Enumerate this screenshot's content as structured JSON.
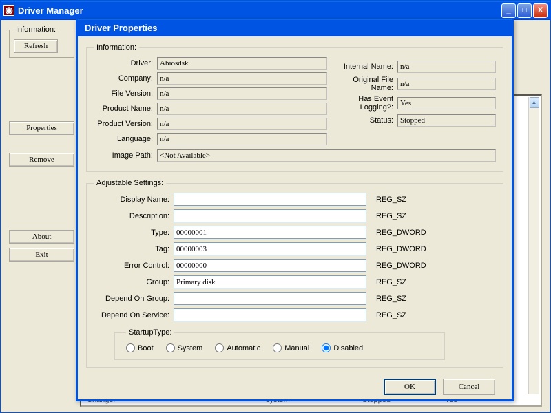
{
  "main": {
    "title": "Driver Manager",
    "info_legend": "Information:",
    "refresh": "Refresh",
    "properties": "Properties",
    "remove": "Remove",
    "about": "About",
    "exit": "Exit",
    "behind_row": {
      "c1": "Changer",
      "c2": "system",
      "c3": "Stopped",
      "c4": "Yes"
    }
  },
  "dialog": {
    "title": "Driver Properties",
    "info_legend": "Information:",
    "adj_legend": "Adjustable Settings:",
    "startup_legend": "StartupType:",
    "ok": "OK",
    "cancel": "Cancel",
    "info": {
      "driver_label": "Driver:",
      "driver": "Abiosdsk",
      "company_label": "Company:",
      "company": "n/a",
      "filever_label": "File Version:",
      "filever": "n/a",
      "prodname_label": "Product Name:",
      "prodname": "n/a",
      "prodver_label": "Product Version:",
      "prodver": "n/a",
      "language_label": "Language:",
      "language": "n/a",
      "image_label": "Image Path:",
      "image": "<Not Available>",
      "internal_label": "Internal Name:",
      "internal": "n/a",
      "origfile_label": "Original File Name:",
      "origfile": "n/a",
      "evlog_label": "Has Event Logging?:",
      "evlog": "Yes",
      "status_label": "Status:",
      "status": "Stopped"
    },
    "adj": {
      "display_label": "Display Name:",
      "display": "",
      "display_t": "REG_SZ",
      "desc_label": "Description:",
      "desc": "",
      "desc_t": "REG_SZ",
      "type_label": "Type:",
      "type": "00000001",
      "type_t": "REG_DWORD",
      "tag_label": "Tag:",
      "tag": "00000003",
      "tag_t": "REG_DWORD",
      "err_label": "Error Control:",
      "err": "00000000",
      "err_t": "REG_DWORD",
      "group_label": "Group:",
      "group": "Primary disk",
      "group_t": "REG_SZ",
      "deg_label": "Depend On Group:",
      "deg": "",
      "deg_t": "REG_SZ",
      "des_label": "Depend On Service:",
      "des": "",
      "des_t": "REG_SZ"
    },
    "startup": {
      "boot": "Boot",
      "system": "System",
      "automatic": "Automatic",
      "manual": "Manual",
      "disabled": "Disabled",
      "selected": "disabled"
    }
  }
}
